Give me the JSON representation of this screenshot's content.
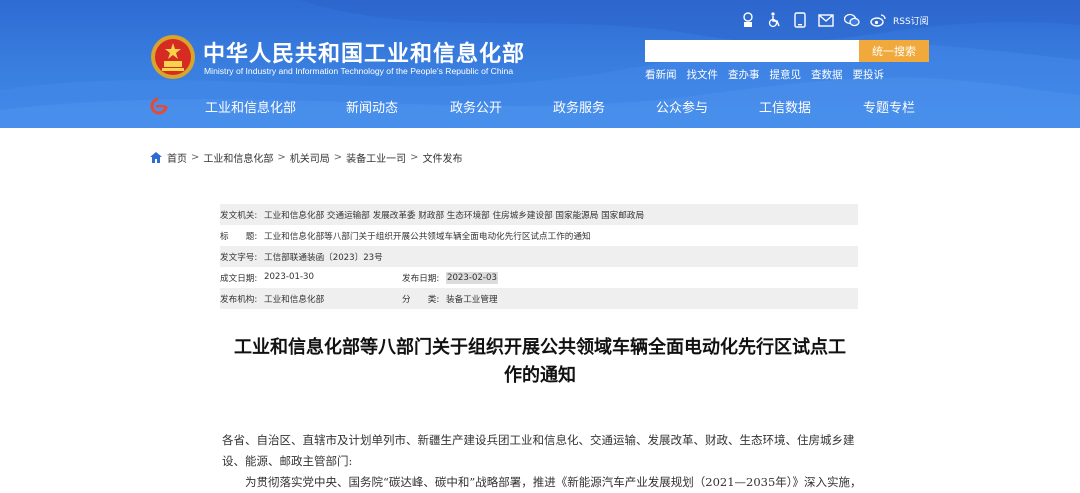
{
  "header": {
    "title": "中华人民共和国工业和信息化部",
    "subtitle": "Ministry of Industry and Information Technology of the People's Republic of China",
    "rss_label": "RSS订阅",
    "search_placeholder": "",
    "search_button": "统一搜索",
    "quick_links": [
      "看新闻",
      "找文件",
      "查办事",
      "提意见",
      "查数据",
      "要投诉"
    ],
    "nav": [
      "工业和信息化部",
      "新闻动态",
      "政务公开",
      "政务服务",
      "公众参与",
      "工信数据",
      "专题专栏"
    ],
    "colors": {
      "header_blue": "#3a7fe0",
      "search_button": "#f0a93a"
    }
  },
  "breadcrumb": [
    "首页",
    "工业和信息化部",
    "机关司局",
    "装备工业一司",
    "文件发布"
  ],
  "meta": {
    "issuer_label": "发文机关:",
    "issuer_value": "工业和信息化部 交通运输部 发展改革委 财政部 生态环境部 住房城乡建设部 国家能源局 国家邮政局",
    "title_label": "标　　题:",
    "title_value": "工业和信息化部等八部门关于组织开展公共领域车辆全面电动化先行区试点工作的通知",
    "docno_label": "发文字号:",
    "docno_value": "工信部联通装函〔2023〕23号",
    "created_label": "成文日期:",
    "created_value": "2023-01-30",
    "published_label": "发布日期:",
    "published_value": "2023-02-03",
    "org_label": "发布机构:",
    "org_value": "工业和信息化部",
    "category_label": "分　　类:",
    "category_value": "装备工业管理"
  },
  "article": {
    "title_line1": "工业和信息化部等八部门关于组织开展公共领域车辆全面电动化先行区试点工",
    "title_line2": "作的通知",
    "salutation_line1": "各省、自治区、直辖市及计划单列市、新疆生产建设兵团工业和信息化、交通运输、发展改革、财政、生态环境、住房城乡建",
    "salutation_line2": "设、能源、邮政主管部门:",
    "para1": "为贯彻落实党中央、国务院“碳达峰、碳中和”战略部署，推进《新能源汽车产业发展规划（2021—2035年）》深入实施，"
  }
}
